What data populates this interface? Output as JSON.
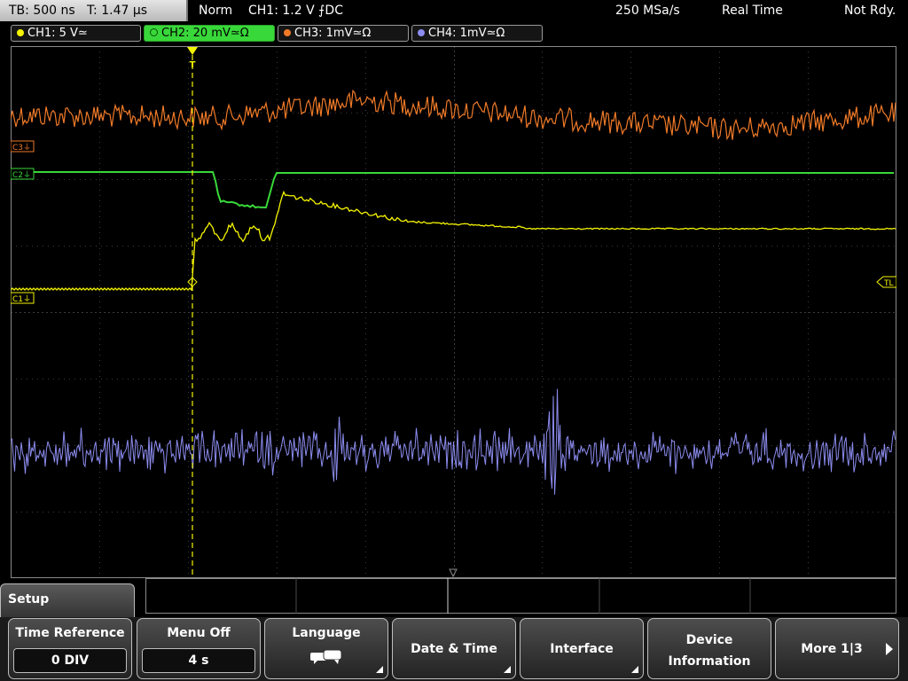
{
  "status": {
    "timebase": "TB: 500 ns",
    "trigger_pos": "T: 1.47 µs",
    "mode": "Norm",
    "trigger_info": "CH1: 1.2 V ⨍DC",
    "sample_rate": "250 MSa/s",
    "acq_mode": "Real Time",
    "state": "Not Rdy."
  },
  "channels": [
    {
      "label": "CH1: 5 V≃",
      "color": "#f5f500"
    },
    {
      "label": "CH2: 20 mV≃Ω",
      "color": "#39d83a"
    },
    {
      "label": "CH3: 1mV≃Ω",
      "color": "#f07a28"
    },
    {
      "label": "CH4: 1mV≃Ω",
      "color": "#8c8cf0"
    }
  ],
  "markers": {
    "c3": "C3⏚",
    "c2": "C2⏚",
    "c1": "C1⏚",
    "trigger_level": "TL",
    "trigger_t": "T"
  },
  "menu": {
    "title": "Setup",
    "time_reference": {
      "label": "Time Reference",
      "value": "0 DIV"
    },
    "menu_off": {
      "label": "Menu Off",
      "value": "4 s"
    },
    "language": {
      "label": "Language",
      "icon": "speech-bubble-icon"
    },
    "date_time": {
      "label": "Date & Time"
    },
    "interface": {
      "label": "Interface"
    },
    "device_info": {
      "line1": "Device",
      "line2": "Information"
    },
    "more": {
      "label": "More 1|3"
    }
  }
}
